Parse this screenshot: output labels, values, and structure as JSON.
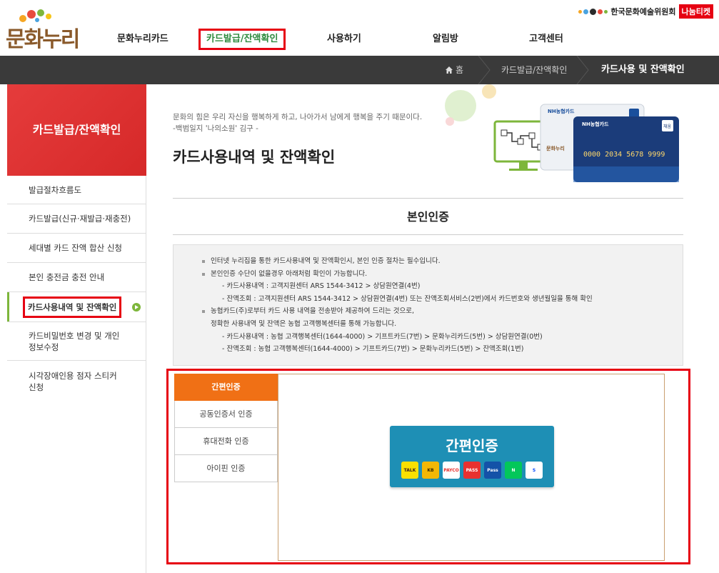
{
  "header": {
    "logo_text": "문화누리",
    "gnb": [
      {
        "label": "문화누리카드"
      },
      {
        "label": "카드발급/잔액확인"
      },
      {
        "label": "사용하기"
      },
      {
        "label": "알림방"
      },
      {
        "label": "고객센터"
      }
    ],
    "org_name": "한국문화예술위원회",
    "org_badge": "나눔티켓"
  },
  "breadcrumb": {
    "home": "홈",
    "level1": "카드발급/잔액확인",
    "level2": "카드사용 및 잔액확인"
  },
  "sidebar": {
    "title": "카드발급/잔액확인",
    "items": [
      {
        "label": "발급절차흐름도"
      },
      {
        "label": "카드발급(신규·재발급·재충전)"
      },
      {
        "label": "세대별 카드 잔액 합산 신청"
      },
      {
        "label": "본인 충전금 충전 안내"
      },
      {
        "label": "카드사용내역 및 잔액확인"
      },
      {
        "label": "카드비밀번호 변경 및 개인 정보수정"
      },
      {
        "label": "시각장애인용 점자 스티커 신청"
      }
    ]
  },
  "main": {
    "quote_line1": "문화의 힘은 우리 자신을 행복하게 하고, 나아가서 남에게 행복을 주기 때문이다.",
    "quote_line2": "-백범일지 '나의소원' 김구 -",
    "title": "카드사용내역 및 잔액확인",
    "hero": {
      "card_brand": "NH농협카드",
      "card_number": "0000 2034 5678 9999",
      "card_badge": "채움"
    },
    "section_title": "본인인증",
    "notice": [
      {
        "text": "인터넷 누리집을 통한 카드사용내역 및 잔액확인시, 본인 인증 절차는 필수입니다.",
        "type": "bullet"
      },
      {
        "text": "본인인증 수단이 없을경우 아래처럼 확인이 가능합니다.",
        "type": "bullet"
      },
      {
        "text": "- 카드사용내역 : 고객지원센터 ARS 1544-3412 > 상담원연결(4번)",
        "type": "sub"
      },
      {
        "text": "- 잔액조회 : 고객지원센터 ARS 1544-3412 > 상담원연결(4번) 또는 잔액조회서비스(2번)에서 카드번호와 생년월일을 통해 확인",
        "type": "sub"
      },
      {
        "text": "농협카드(주)로부터 카드 사용 내역을 전송받아 제공하여 드리는 것으로,",
        "type": "bullet"
      },
      {
        "text": "정확한 사용내역 및 잔액은 농협 고객행복센터를 통해 가능합니다.",
        "type": "plain"
      },
      {
        "text": "- 카드사용내역 : 농협 고객행복센터(1644-4000) > 기프트카드(7번) > 문화누리카드(5번) > 상담원연결(0번)",
        "type": "sub"
      },
      {
        "text": "- 잔액조회 : 농협 고객행복센터(1644-4000) > 기프트카드(7번) > 문화누리카드(5번) > 잔액조회(1번)",
        "type": "sub"
      }
    ],
    "auth_tabs": [
      {
        "label": "간편인증"
      },
      {
        "label": "공동인증서 인증"
      },
      {
        "label": "휴대전화 인증"
      },
      {
        "label": "아이핀 인증"
      }
    ],
    "easy_auth": {
      "title": "간편인증",
      "providers": [
        {
          "label": "TALK",
          "color": "#f9e000",
          "text_color": "#3a1d1d"
        },
        {
          "label": "KB",
          "color": "#f2b705",
          "text_color": "#3a2a00"
        },
        {
          "label": "PAYCO",
          "color": "#ffffff",
          "text_color": "#e8312f"
        },
        {
          "label": "PASS",
          "color": "#e8312f",
          "text_color": "#ffffff"
        },
        {
          "label": "Pass",
          "color": "#1452a8",
          "text_color": "#ffffff"
        },
        {
          "label": "N",
          "color": "#03c75a",
          "text_color": "#ffffff"
        },
        {
          "label": "S",
          "color": "#ffffff",
          "text_color": "#0046ff"
        }
      ]
    }
  }
}
